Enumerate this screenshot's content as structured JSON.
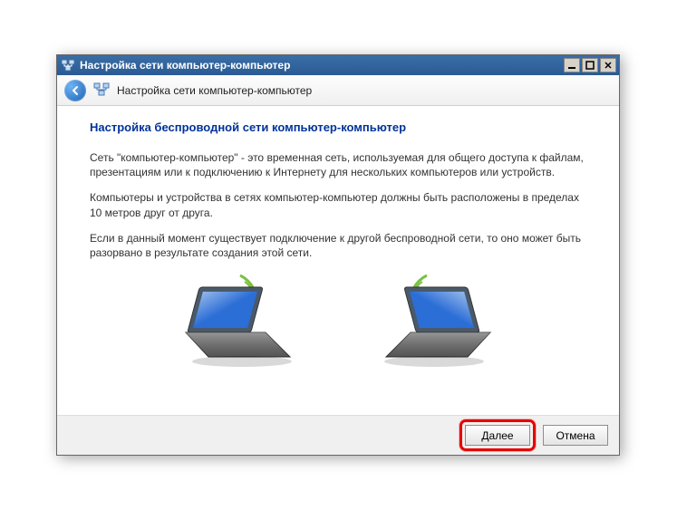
{
  "titlebar": {
    "title": "Настройка сети компьютер-компьютер"
  },
  "header": {
    "title": "Настройка сети компьютер-компьютер"
  },
  "content": {
    "heading": "Настройка беспроводной сети компьютер-компьютер",
    "p1": "Сеть \"компьютер-компьютер\" - это временная сеть, используемая для общего доступа к файлам, презентациям или к подключению к Интернету для нескольких компьютеров или устройств.",
    "p2": "Компьютеры и устройства в сетях компьютер-компьютер должны быть расположены в пределах 10 метров друг от друга.",
    "p3": "Если в данный момент существует подключение к другой беспроводной сети, то оно может быть разорвано в результате создания этой сети."
  },
  "footer": {
    "next": "Далее",
    "cancel": "Отмена"
  }
}
